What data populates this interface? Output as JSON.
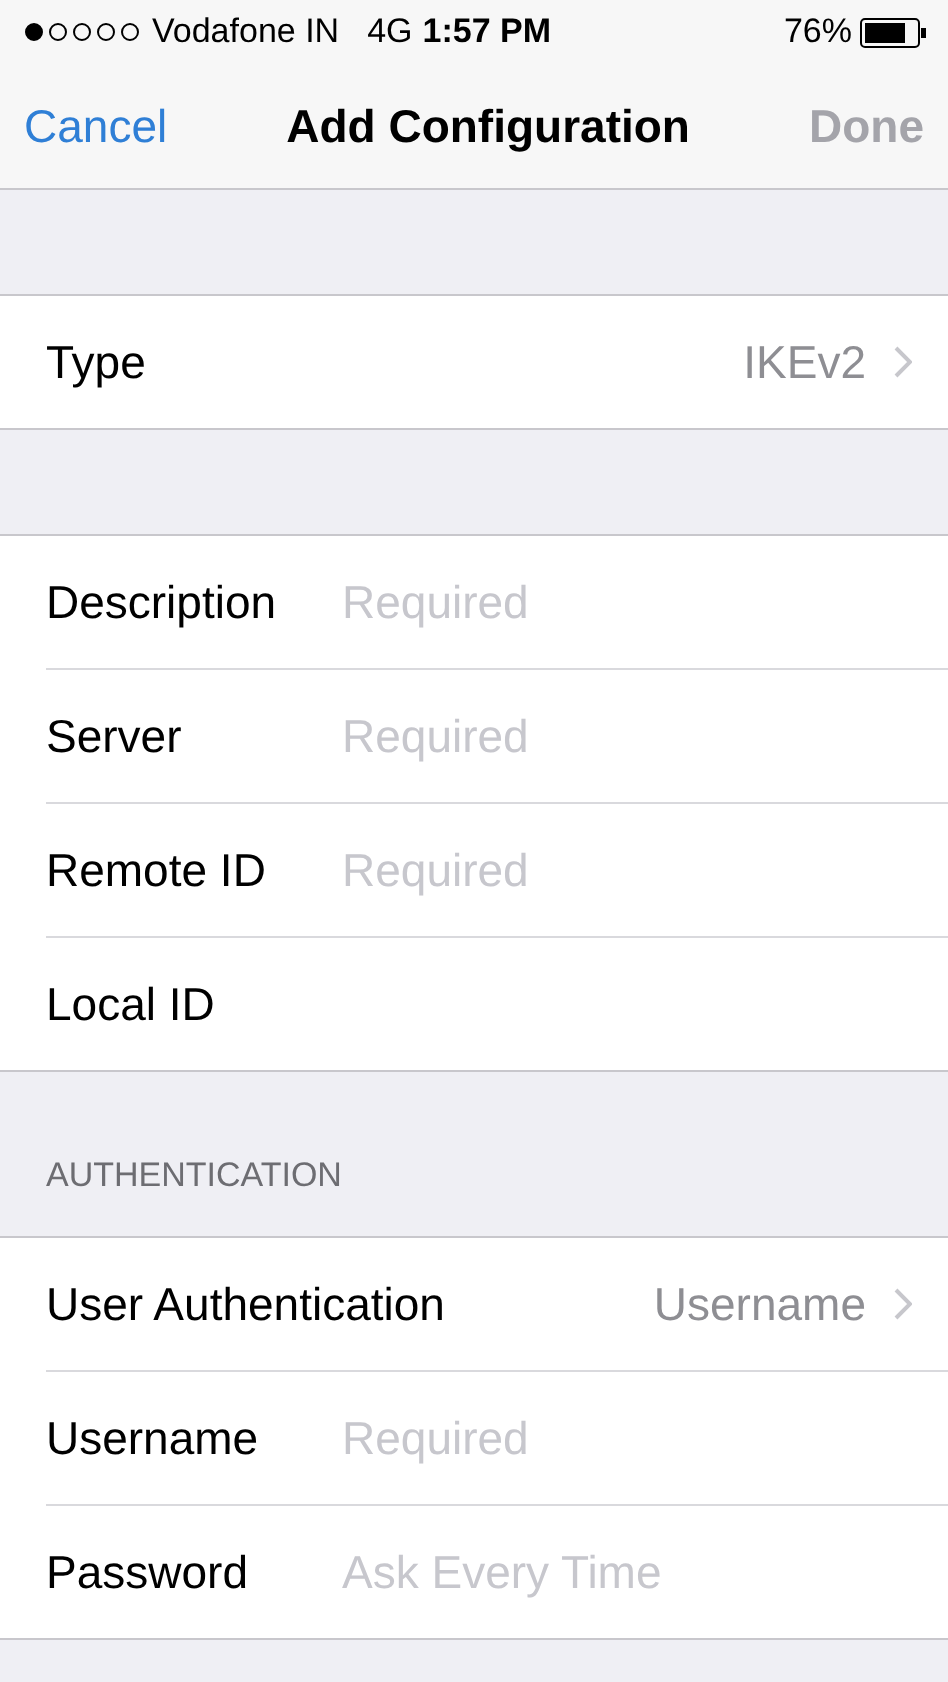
{
  "status_bar": {
    "carrier": "Vodafone IN",
    "network": "4G",
    "time": "1:57 PM",
    "battery": "76%"
  },
  "nav": {
    "cancel": "Cancel",
    "title": "Add Configuration",
    "done": {
      "label": "Done",
      "disabled": true
    }
  },
  "sections": [
    {
      "rows": [
        {
          "kind": "disclosure",
          "label": "Type",
          "value": "IKEv2"
        }
      ]
    },
    {
      "rows": [
        {
          "kind": "field",
          "label": "Description",
          "placeholder": "Required"
        },
        {
          "kind": "field",
          "label": "Server",
          "placeholder": "Required"
        },
        {
          "kind": "field",
          "label": "Remote ID",
          "placeholder": "Required"
        },
        {
          "kind": "field",
          "label": "Local ID"
        }
      ]
    },
    {
      "header": "AUTHENTICATION",
      "rows": [
        {
          "kind": "disclosure",
          "label": "User Authentication",
          "value": "Username"
        },
        {
          "kind": "field",
          "label": "Username",
          "placeholder": "Required"
        },
        {
          "kind": "field",
          "label": "Password",
          "placeholder": "Ask Every Time"
        }
      ]
    }
  ]
}
